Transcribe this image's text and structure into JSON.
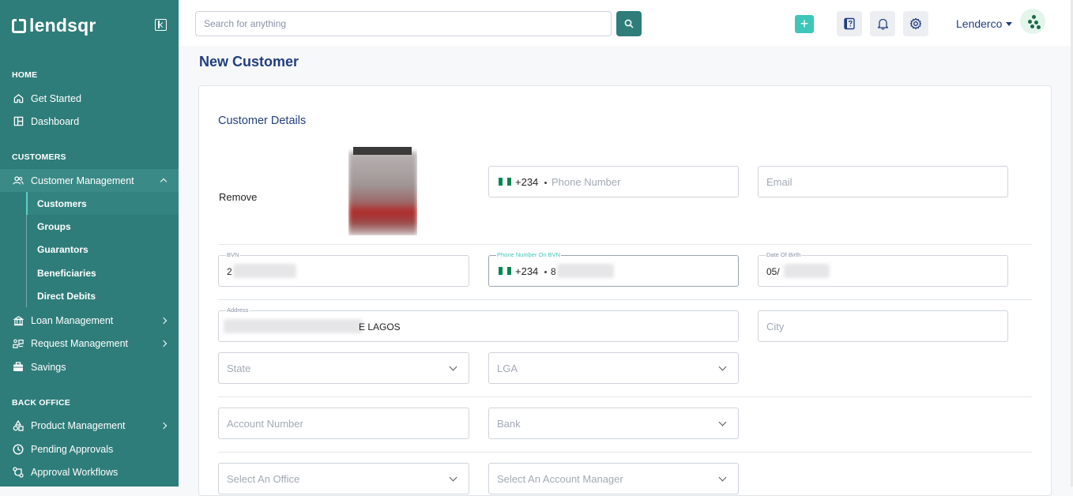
{
  "sidebar": {
    "logo_text": "lendsqr",
    "sections": {
      "home": "HOME",
      "customers": "CUSTOMERS",
      "back_office": "BACK OFFICE"
    },
    "items": {
      "get_started": "Get Started",
      "dashboard": "Dashboard",
      "customer_management": "Customer Management",
      "loan_management": "Loan Management",
      "request_management": "Request Management",
      "savings": "Savings",
      "product_management": "Product Management",
      "pending_approvals": "Pending Approvals",
      "approval_workflows": "Approval Workflows"
    },
    "sub_items": {
      "customers": "Customers",
      "groups": "Groups",
      "guarantors": "Guarantors",
      "beneficiaries": "Beneficiaries",
      "direct_debits": "Direct Debits"
    }
  },
  "topbar": {
    "search_placeholder": "Search for anything",
    "user_name": "Lenderco"
  },
  "main": {
    "page_title": "New Customer",
    "card_title": "Customer Details",
    "remove_label": "Remove",
    "fields": {
      "phone": {
        "dial_code": "+234",
        "placeholder": "Phone Number"
      },
      "email": {
        "placeholder": "Email"
      },
      "bvn": {
        "label": "BVN",
        "value_visible": "2"
      },
      "phone_bvn": {
        "label": "Phone Number On BVN",
        "dial_code": "+234",
        "value_visible": "8"
      },
      "dob": {
        "label": "Date Of Birth",
        "value_visible": "05/"
      },
      "address": {
        "label": "Address",
        "value_visible": "E LAGOS"
      },
      "city": {
        "placeholder": "City"
      },
      "state": {
        "placeholder": "State"
      },
      "lga": {
        "placeholder": "LGA"
      },
      "account_number": {
        "placeholder": "Account Number"
      },
      "bank": {
        "placeholder": "Bank"
      },
      "office": {
        "placeholder": "Select An Office"
      },
      "account_manager": {
        "placeholder": "Select An Account Manager"
      }
    }
  },
  "colors": {
    "sidebar_bg": "#2e7d7a",
    "accent": "#3ec6b8",
    "title": "#213f7d",
    "flag_green": "#008751"
  }
}
